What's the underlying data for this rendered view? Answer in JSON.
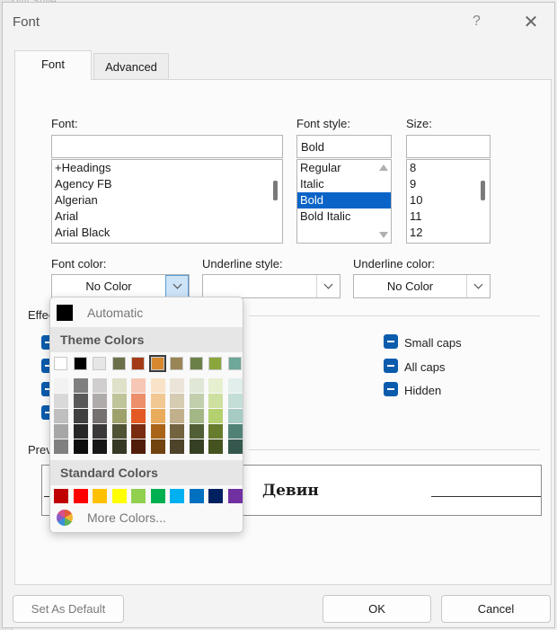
{
  "background": {
    "text": "dity Style"
  },
  "window": {
    "title": "Font",
    "help": "?",
    "close": "✕"
  },
  "tabs": [
    {
      "label": "Font"
    },
    {
      "label": "Advanced"
    }
  ],
  "font": {
    "label": "Font:",
    "value": "",
    "list": [
      "+Headings",
      "Agency FB",
      "Algerian",
      "Arial",
      "Arial Black"
    ]
  },
  "style": {
    "label": "Font style:",
    "value": "Bold",
    "list": [
      "Regular",
      "Italic",
      "Bold",
      "Bold Italic"
    ],
    "selected": "Bold"
  },
  "size": {
    "label": "Size:",
    "value": "",
    "list": [
      "8",
      "9",
      "10",
      "11",
      "12"
    ]
  },
  "font_color": {
    "label": "Font color:",
    "value": "No Color"
  },
  "underline_style": {
    "label": "Underline style:",
    "value": ""
  },
  "underline_color": {
    "label": "Underline color:",
    "value": "No Color"
  },
  "effects": {
    "label": "Effec",
    "items": [
      {
        "label": "Small caps"
      },
      {
        "label": "All caps"
      },
      {
        "label": "Hidden"
      }
    ]
  },
  "preview": {
    "label": "Prev",
    "text": "Девин"
  },
  "buttons": {
    "set_default": "Set As Default",
    "ok": "OK",
    "cancel": "Cancel"
  },
  "color_popup": {
    "automatic_label": "Automatic",
    "theme_header": "Theme Colors",
    "standard_header": "Standard Colors",
    "more_label": "More Colors...",
    "theme_base": [
      "#ffffff",
      "#000000",
      "#e7e6e6",
      "#6b7048",
      "#a33b16",
      "#d7882e",
      "#9a8557",
      "#6b8048",
      "#8aa63d",
      "#6da89a"
    ],
    "selected_index": 5,
    "theme_shades": [
      [
        "#f2f2f2",
        "#d9d9d9",
        "#bfbfbf",
        "#a6a6a6",
        "#808080"
      ],
      [
        "#808080",
        "#595959",
        "#404040",
        "#262626",
        "#0d0d0d"
      ],
      [
        "#d0cece",
        "#afabab",
        "#767171",
        "#3a3838",
        "#171616"
      ],
      [
        "#dfe1c8",
        "#c0c49a",
        "#9ea16b",
        "#505435",
        "#353824"
      ],
      [
        "#f6c7b5",
        "#ed8f6b",
        "#e35a25",
        "#7a2c10",
        "#511d0b"
      ],
      [
        "#f8e3c8",
        "#f1c792",
        "#e9ab5c",
        "#a96418",
        "#704310"
      ],
      [
        "#ebe5d9",
        "#d6cbb3",
        "#c2b08d",
        "#73633f",
        "#4d422a"
      ],
      [
        "#e0e7d6",
        "#c1cfad",
        "#a2b785",
        "#505f35",
        "#353f24"
      ],
      [
        "#e6efcf",
        "#cde09f",
        "#b4d06f",
        "#677c2d",
        "#45531e"
      ],
      [
        "#e1eeeb",
        "#c3ddd7",
        "#a5cbc3",
        "#4f8275",
        "#35574e"
      ]
    ],
    "standard": [
      "#c00000",
      "#ff0000",
      "#ffc000",
      "#ffff00",
      "#92d050",
      "#00b050",
      "#00b0f0",
      "#0070c0",
      "#002060",
      "#7030a0"
    ]
  }
}
